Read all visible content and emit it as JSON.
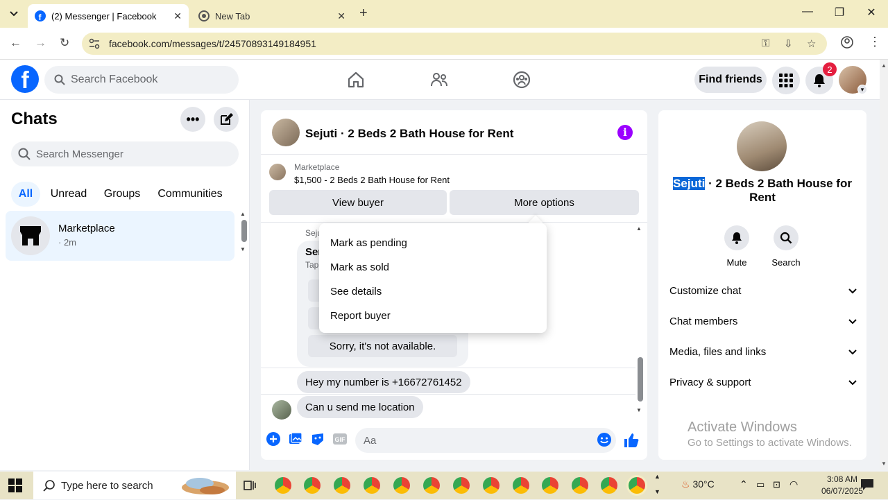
{
  "browser": {
    "tabs": [
      {
        "title": "(2) Messenger | Facebook",
        "active": true
      },
      {
        "title": "New Tab",
        "active": false
      }
    ],
    "url": "facebook.com/messages/t/24570893149184951"
  },
  "header": {
    "search_placeholder": "Search Facebook",
    "find_friends": "Find friends",
    "notification_count": "2"
  },
  "chats": {
    "title": "Chats",
    "search_placeholder": "Search Messenger",
    "filters": [
      "All",
      "Unread",
      "Groups",
      "Communities"
    ],
    "items": [
      {
        "name": "Marketplace",
        "time": "· 2m"
      }
    ]
  },
  "conversation": {
    "title": "Sejuti · 2 Beds 2 Bath House for Rent",
    "marketplace_label": "Marketplace",
    "listing": "$1,500 - 2 Beds 2 Bath House for Rent",
    "view_buyer": "View buyer",
    "more_options": "More options",
    "sender_partial": "Seju",
    "partial_line1": "Ser",
    "partial_line2": "Tap",
    "sorry_reply": "Sorry, it's not available.",
    "messages": [
      {
        "text": "Hey  my number is +16672761452"
      },
      {
        "text": "Can u send me location"
      }
    ],
    "input_placeholder": "Aa"
  },
  "dropdown": {
    "items": [
      "Mark as pending",
      "Mark as sold",
      "See details",
      "Report buyer"
    ]
  },
  "details": {
    "name_highlight": "Sejuti",
    "title_rest": " · 2 Beds 2 Bath House for Rent",
    "actions": [
      "Mute",
      "Search"
    ],
    "sections": [
      "Customize chat",
      "Chat members",
      "Media, files and links",
      "Privacy & support"
    ]
  },
  "watermark": {
    "line1": "Activate Windows",
    "line2": "Go to Settings to activate Windows."
  },
  "taskbar": {
    "search_placeholder": "Type here to search",
    "temperature": "30°C",
    "time": "3:08 AM",
    "date": "06/07/2025"
  },
  "colors": {
    "fb_blue": "#0866ff",
    "info_purple": "#9b00ff",
    "badge_red": "#e41e3f",
    "selection": "#0a67d8"
  }
}
